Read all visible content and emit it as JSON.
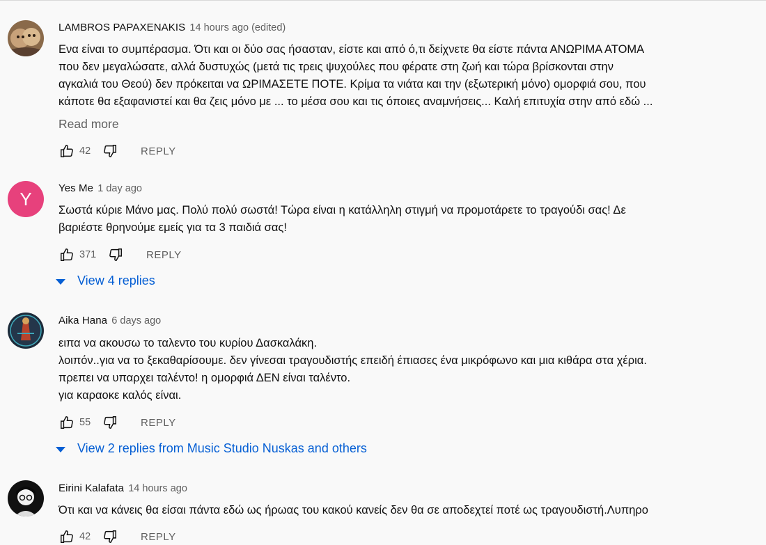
{
  "comments": [
    {
      "author": "LAMBROS PAPAXENAKIS",
      "time": "14 hours ago (edited)",
      "lines": [
        "Ενα είναι το συμπέρασμα. Ότι και οι δύο σας ήσασταν, είστε και από ό,τι δείχνετε θα είστε πάντα ΑΝΩΡΙΜΑ ΑΤΟΜΑ",
        "που δεν μεγαλώσατε, αλλά δυστυχώς (μετά τις τρεις ψυχούλες που φέρατε στη ζωή και τώρα βρίσκονται στην",
        "αγκαλιά του Θεού) δεν πρόκειται να ΩΡΙΜΑΣΕΤΕ ΠΟΤΕ. Κρίμα τα νιάτα και την (εξωτερική μόνο) ομορφιά σου, που",
        "κάποτε θα εξαφανιστεί και θα ζεις μόνο με ... το μέσα σου και τις όποιες αναμνήσεις... Καλή επιτυχία στην από εδώ ..."
      ],
      "read_more": "Read more",
      "likes": "42",
      "reply": "REPLY"
    },
    {
      "author": "Yes Me",
      "time": "1 day ago",
      "avatar_letter": "Y",
      "lines": [
        "Σωστά κύριε Μάνο μας. Πολύ πολύ σωστά! Τώρα είναι η κατάλληλη στιγμή να προμοτάρετε το τραγούδι σας! Δε",
        "βαριέστε θρηνούμε εμείς για τα 3 παιδιά σας!"
      ],
      "likes": "371",
      "reply": "REPLY",
      "view_replies": "View 4 replies"
    },
    {
      "author": "Aika Hana",
      "time": "6 days ago",
      "lines": [
        "ειπα να ακουσω το ταλεντο του κυρίου Δασκαλάκη.",
        "λοιπόν..για να το ξεκαθαρίσουμε. δεν γίνεσαι τραγουδιστής επειδή έπιασες ένα μικρόφωνο και μια κιθάρα στα χέρια.",
        "πρεπει να υπαρχει ταλέντο! η ομορφιά ΔΕΝ είναι ταλέντο.",
        "για καραοκε καλός είναι."
      ],
      "likes": "55",
      "reply": "REPLY",
      "view_replies": "View 2 replies from Music Studio Nuskas and others"
    },
    {
      "author": "Eirini Kalafata",
      "time": "14 hours ago",
      "lines": [
        "Ότι και να κάνεις θα είσαι πάντα εδώ ως ήρωας του κακού κανείς δεν θα σε αποδεχτεί ποτέ ως τραγουδιστή.Λυπηρο"
      ],
      "likes": "42",
      "reply": "REPLY"
    }
  ],
  "colors": {
    "background": "#f9f9f9",
    "link_blue": "#065fd4",
    "secondary_text": "#606060",
    "avatar_pink": "#e7417c"
  }
}
